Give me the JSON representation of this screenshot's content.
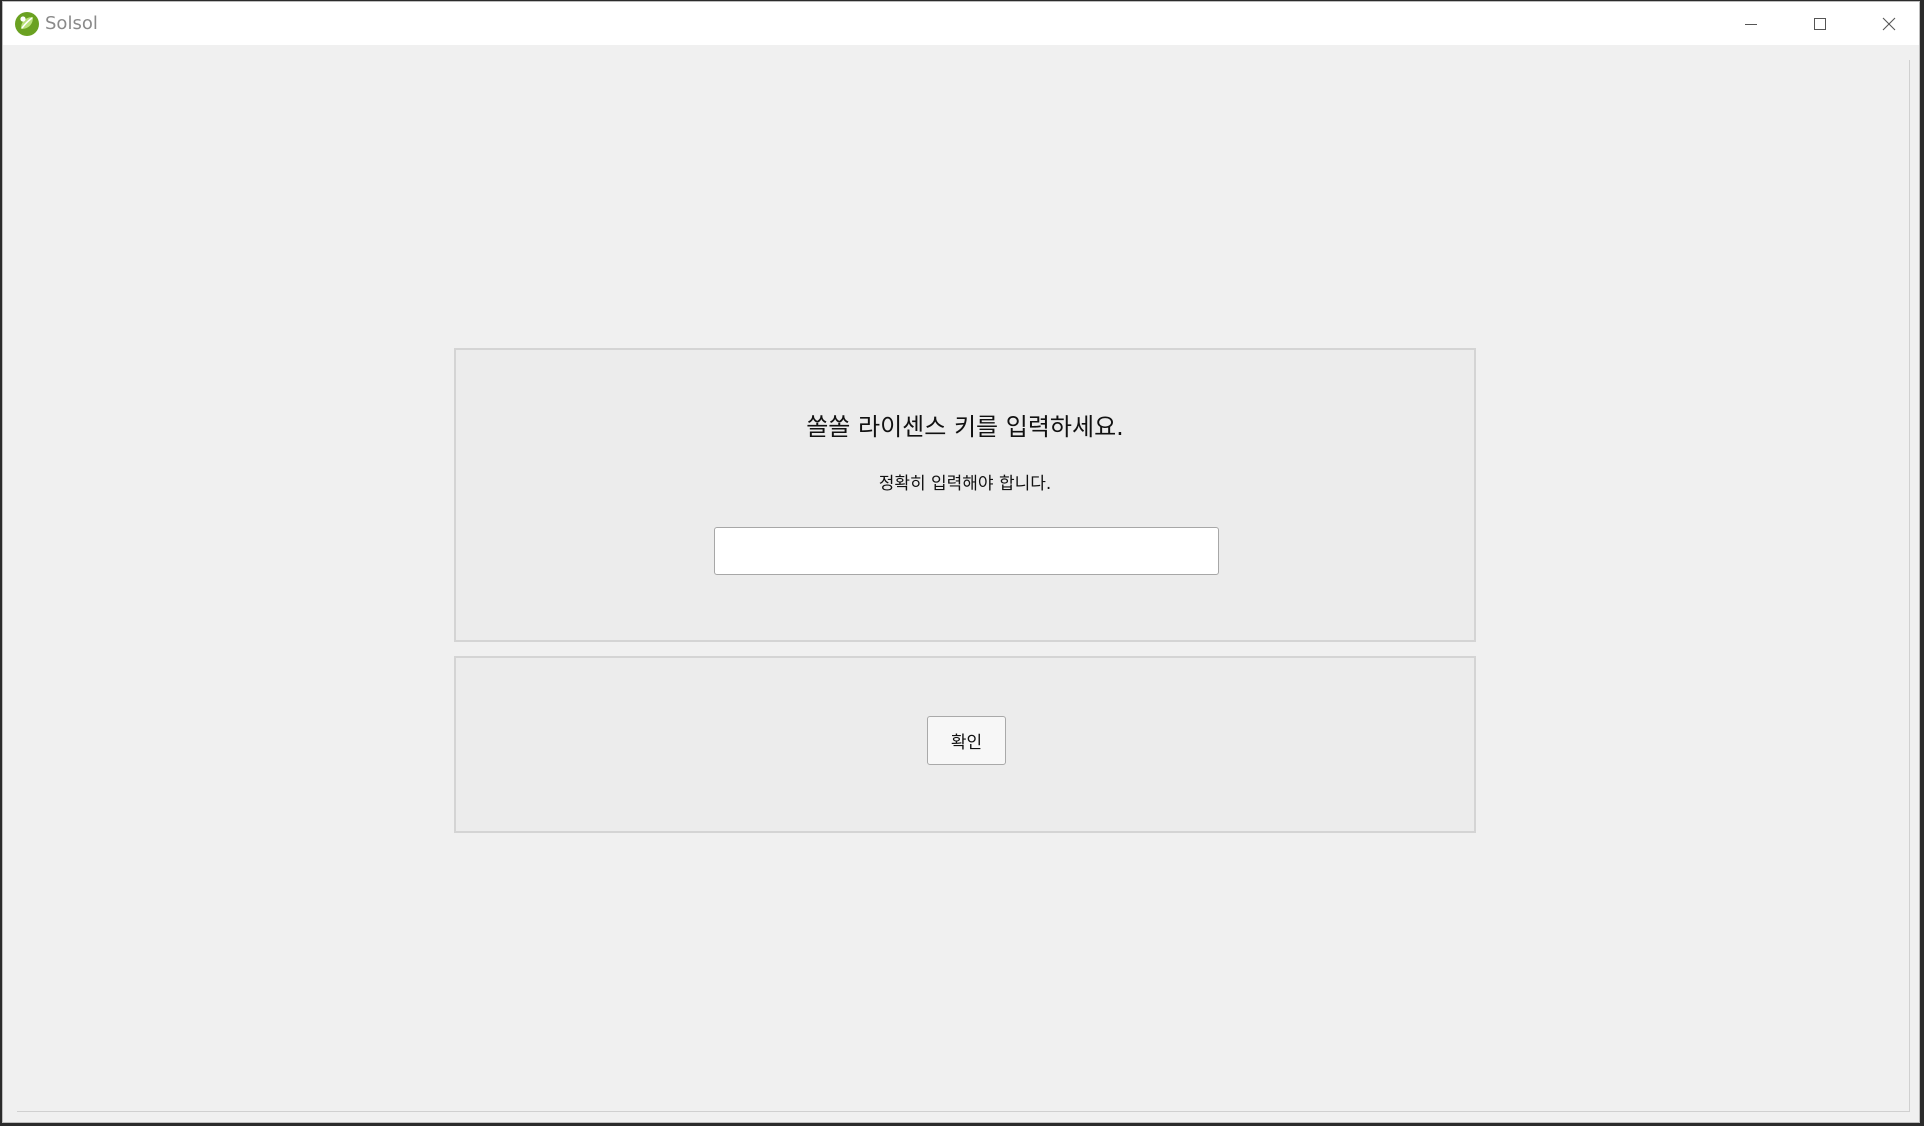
{
  "window": {
    "title": "Solsol",
    "icon": "solsol-leaf-icon",
    "controls": {
      "minimize": "minimize-icon",
      "maximize": "maximize-icon",
      "close": "close-icon"
    }
  },
  "license_panel": {
    "heading": "쏠쏠 라이센스 키를 입력하세요.",
    "subtext": "정확히 입력해야 합니다.",
    "license_input": {
      "value": "",
      "placeholder": ""
    }
  },
  "action_panel": {
    "confirm_label": "확인"
  },
  "colors": {
    "accent": "#6aa121",
    "background": "#f0f0f0",
    "panel": "#ececec"
  }
}
